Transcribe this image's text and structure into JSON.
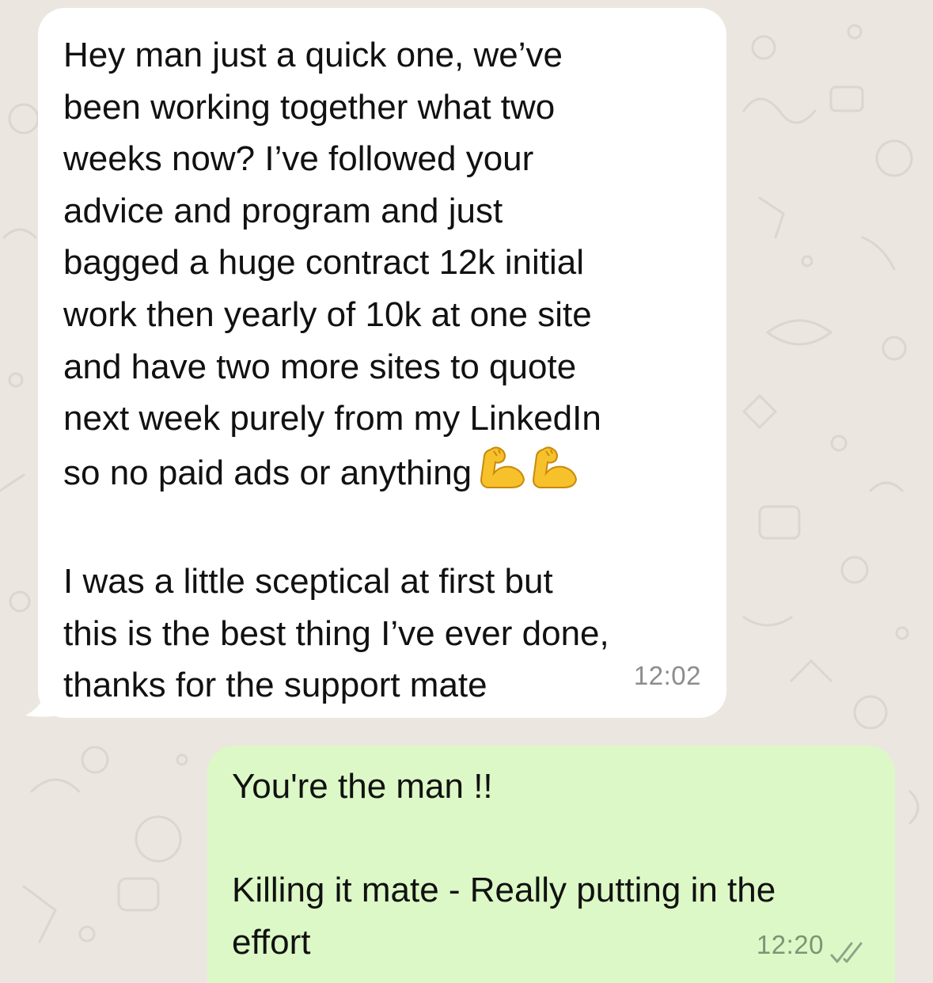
{
  "chat": {
    "background_color": "#ebe6e0",
    "incoming_bubble_color": "#ffffff",
    "outgoing_bubble_color": "#dcf8c6"
  },
  "messages": [
    {
      "direction": "incoming",
      "paragraph_1_lines": [
        "Hey man just a quick one, we’ve",
        "been working together what two",
        "weeks now? I’ve followed your",
        "advice and program and just",
        "bagged a huge contract 12k initial",
        "work then yearly of 10k at one site",
        "and have two more sites to quote",
        "next week purely from my LinkedIn",
        "so no paid ads or anything"
      ],
      "emoji": [
        "flexed-biceps-icon",
        "flexed-biceps-icon"
      ],
      "paragraph_2_lines": [
        "I was a little sceptical at first but",
        "this is the best thing I’ve ever done,",
        "thanks for the support mate"
      ],
      "time": "12:02"
    },
    {
      "direction": "outgoing",
      "line_1": "You're the man !!",
      "line_2": "Killing it mate - Really putting in the",
      "line_3": "effort",
      "time": "12:20",
      "status_icon": "read-double-check-icon"
    }
  ]
}
